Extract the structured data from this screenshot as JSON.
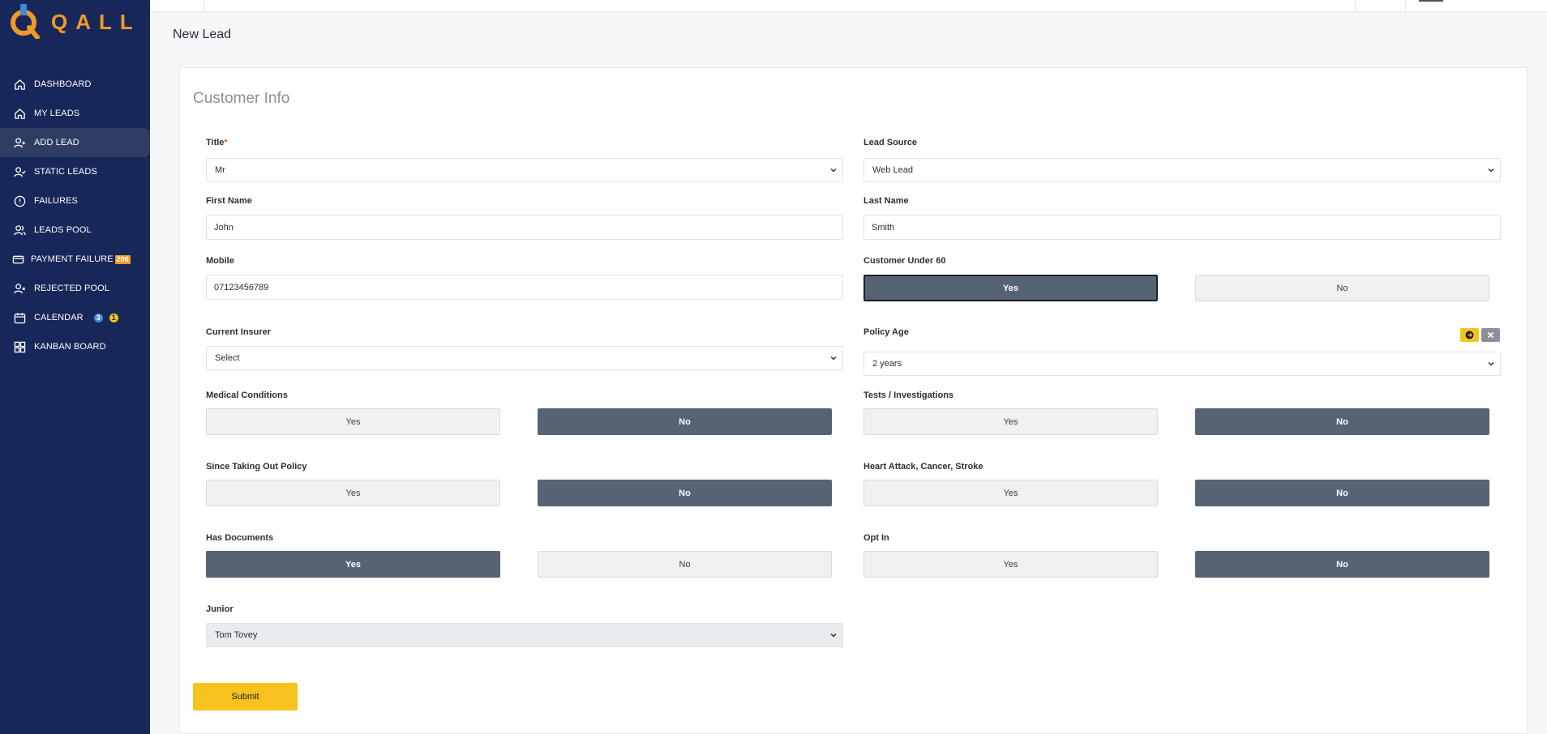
{
  "brand": {
    "logo_text": "QALL"
  },
  "sidebar": {
    "items": [
      {
        "label": "DASHBOARD",
        "icon": "home-icon"
      },
      {
        "label": "MY LEADS",
        "icon": "home-icon"
      },
      {
        "label": "ADD LEAD",
        "icon": "user-plus-icon",
        "active": true
      },
      {
        "label": "STATIC LEADS",
        "icon": "user-check-icon"
      },
      {
        "label": "FAILURES",
        "icon": "alert-circle-icon"
      },
      {
        "label": "LEADS POOL",
        "icon": "users-icon"
      },
      {
        "label": "PAYMENT FAILURE",
        "icon": "credit-card-icon",
        "badge": "206"
      },
      {
        "label": "REJECTED POOL",
        "icon": "user-x-icon"
      },
      {
        "label": "CALENDAR",
        "icon": "calendar-icon",
        "badges": [
          "3",
          "1"
        ]
      },
      {
        "label": "KANBAN BOARD",
        "icon": "grid-icon"
      }
    ]
  },
  "page": {
    "title": "New Lead"
  },
  "form": {
    "section_title": "Customer Info",
    "title": {
      "label": "Title",
      "required_mark": "*",
      "value": "Mr"
    },
    "lead_source": {
      "label": "Lead Source",
      "value": "Web Lead"
    },
    "first_name": {
      "label": "First Name",
      "value": "John"
    },
    "last_name": {
      "label": "Last Name",
      "value": "Smith"
    },
    "mobile": {
      "label": "Mobile",
      "value": "07123456789"
    },
    "customer_under_60": {
      "label": "Customer Under 60",
      "yes": "Yes",
      "no": "No",
      "selected": "Yes"
    },
    "current_insurer": {
      "label": "Current Insurer",
      "value": "Select"
    },
    "policy_age": {
      "label": "Policy Age",
      "value": "2 years"
    },
    "medical_conditions": {
      "label": "Medical Conditions",
      "yes": "Yes",
      "no": "No",
      "selected": "No"
    },
    "tests_investigations": {
      "label": "Tests / Investigations",
      "yes": "Yes",
      "no": "No",
      "selected": "No"
    },
    "since_taking_out_policy": {
      "label": "Since Taking Out Policy",
      "yes": "Yes",
      "no": "No",
      "selected": "No"
    },
    "heart_attack_cancer_stroke": {
      "label": "Heart Attack, Cancer, Stroke",
      "yes": "Yes",
      "no": "No",
      "selected": "No"
    },
    "has_documents": {
      "label": "Has Documents",
      "yes": "Yes",
      "no": "No",
      "selected": "Yes"
    },
    "opt_in": {
      "label": "Opt In",
      "yes": "Yes",
      "no": "No",
      "selected": "No"
    },
    "junior": {
      "label": "Junior",
      "value": "Tom Tovey"
    },
    "submit_label": "Submit"
  }
}
